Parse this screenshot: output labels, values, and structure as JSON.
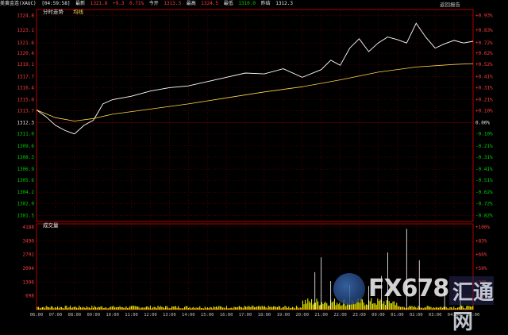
{
  "header": {
    "symbol": "美黄金连(XAUC)",
    "time": "[04:59:58]",
    "latest_label": "最新",
    "latest_value": "1321.8",
    "change": "+9.3",
    "change_pct": "0.71%",
    "today_open_label": "今开",
    "today_open_value": "1313.3",
    "high_label": "最高",
    "high_value": "1324.5",
    "low_label": "最低",
    "low_value": "1310.0",
    "prev_close_label": "昨结",
    "prev_close_value": "1312.3"
  },
  "labels": {
    "price_panel": "分时走势",
    "avg_line": "均线",
    "volume_panel": "成交量",
    "return_link": "返回报告"
  },
  "colors": {
    "up": "#ff3b3b",
    "down": "#00d000",
    "flat": "#e6e6e6",
    "price": "#ffffff",
    "avg": "#ffd84a",
    "grid": "#6e0000",
    "volume": "#ffff00"
  },
  "watermark": {
    "text": "FX678",
    "chinese": "汇通网"
  },
  "chart_data": {
    "type": "line",
    "y_left_ticks": [
      "1324.8",
      "1323.1",
      "1321.6",
      "1320.4",
      "1319.1",
      "1317.7",
      "1316.4",
      "1315.0",
      "1313.7",
      "1312.3",
      "1311.0",
      "1309.6",
      "1308.3",
      "1306.9",
      "1305.6",
      "1304.2",
      "1302.9",
      "1301.5"
    ],
    "y_right_ticks": [
      "+0.93%",
      "+0.83%",
      "+0.72%",
      "+0.62%",
      "+0.52%",
      "+0.41%",
      "+0.31%",
      "+0.21%",
      "+0.10%",
      "0.00%",
      "-0.10%",
      "-0.21%",
      "-0.31%",
      "-0.41%",
      "-0.51%",
      "-0.62%",
      "-0.72%",
      "-0.82%"
    ],
    "prev_close": 1312.3,
    "ylim": [
      1300.8,
      1325.5
    ],
    "x_ticks": [
      "06:00",
      "07:00",
      "08:00",
      "09:00",
      "10:00",
      "11:00",
      "12:00",
      "13:00",
      "14:00",
      "15:00",
      "16:00",
      "17:00",
      "18:00",
      "19:00",
      "20:00",
      "21:00",
      "22:00",
      "23:00",
      "00:00",
      "01:00",
      "02:00",
      "03:00",
      "04:00",
      "05:00"
    ],
    "series": [
      {
        "name": "分时走势",
        "x": [
          "06:00",
          "06:30",
          "07:00",
          "07:30",
          "08:00",
          "08:30",
          "09:00",
          "09:30",
          "10:00",
          "11:00",
          "12:00",
          "13:00",
          "14:00",
          "15:00",
          "16:00",
          "17:00",
          "18:00",
          "19:00",
          "20:00",
          "21:00",
          "21:30",
          "22:00",
          "22:30",
          "23:00",
          "23:30",
          "00:00",
          "00:30",
          "01:00",
          "01:30",
          "02:00",
          "02:30",
          "03:00",
          "03:30",
          "04:00",
          "04:30",
          "05:00"
        ],
        "values": [
          1313.8,
          1313.0,
          1312.0,
          1311.4,
          1311.0,
          1312.0,
          1312.6,
          1314.5,
          1315.0,
          1315.4,
          1316.0,
          1316.4,
          1316.6,
          1317.1,
          1317.6,
          1318.1,
          1318.0,
          1318.6,
          1317.6,
          1318.5,
          1319.6,
          1319.0,
          1321.0,
          1322.1,
          1320.6,
          1321.6,
          1322.3,
          1322.0,
          1321.6,
          1323.9,
          1322.3,
          1321.0,
          1321.5,
          1321.9,
          1321.6,
          1321.8
        ]
      },
      {
        "name": "均线",
        "x": [
          "06:00",
          "07:00",
          "08:00",
          "09:00",
          "10:00",
          "12:00",
          "14:00",
          "16:00",
          "18:00",
          "20:00",
          "22:00",
          "00:00",
          "02:00",
          "04:00",
          "05:00"
        ],
        "values": [
          1313.8,
          1312.9,
          1312.5,
          1312.8,
          1313.3,
          1313.9,
          1314.5,
          1315.2,
          1315.9,
          1316.5,
          1317.3,
          1318.2,
          1318.8,
          1319.1,
          1319.2
        ]
      }
    ],
    "volume": {
      "y_ticks": [
        "4188",
        "3490",
        "2792",
        "2094",
        "1396",
        "698"
      ],
      "y_right_ticks": [
        "+100%",
        "+83%",
        "+66%",
        "+50%",
        "+33%",
        "+16%"
      ],
      "ylim": [
        0,
        4188
      ],
      "spikes": [
        {
          "x": "20:40",
          "value": 1900
        },
        {
          "x": "21:00",
          "value": 2650
        },
        {
          "x": "21:30",
          "value": 1450
        },
        {
          "x": "22:30",
          "value": 1250
        },
        {
          "x": "23:30",
          "value": 1200
        },
        {
          "x": "00:10",
          "value": 1700
        },
        {
          "x": "00:30",
          "value": 2900
        },
        {
          "x": "01:30",
          "value": 4100
        },
        {
          "x": "02:10",
          "value": 2500
        },
        {
          "x": "03:30",
          "value": 1400
        },
        {
          "x": "04:20",
          "value": 1000
        }
      ]
    }
  }
}
